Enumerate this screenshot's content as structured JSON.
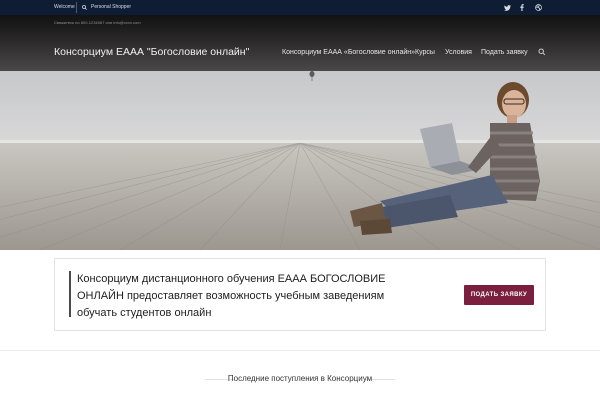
{
  "topbar": {
    "welcome": "Welcome",
    "personal_shopper": "Personal Shopper",
    "social": [
      "twitter-icon",
      "facebook-icon",
      "dribbble-icon"
    ]
  },
  "header": {
    "contact": "Свяжитесь по 800-1234567 или info@xxxx.com",
    "brand": "Консорциум ЕААА \"Богословие онлайн\"",
    "nav": [
      "Консорциум ЕААА «Богословие онлайн»",
      "Курсы",
      "Условия",
      "Подать заявку"
    ]
  },
  "callout": {
    "text": "Консорциум дистанционного обучения ЕААА БОГОСЛОВИЕ ОНЛАЙН предоставляет возможность учебным заведениям обучать студентов онлайн",
    "button": "ПОДАТЬ ЗАЯВКУ"
  },
  "section": {
    "title": "Последние поступления в Консорциум"
  },
  "colors": {
    "topbar": "#0e1d33",
    "accent": "#7a1f3d"
  }
}
